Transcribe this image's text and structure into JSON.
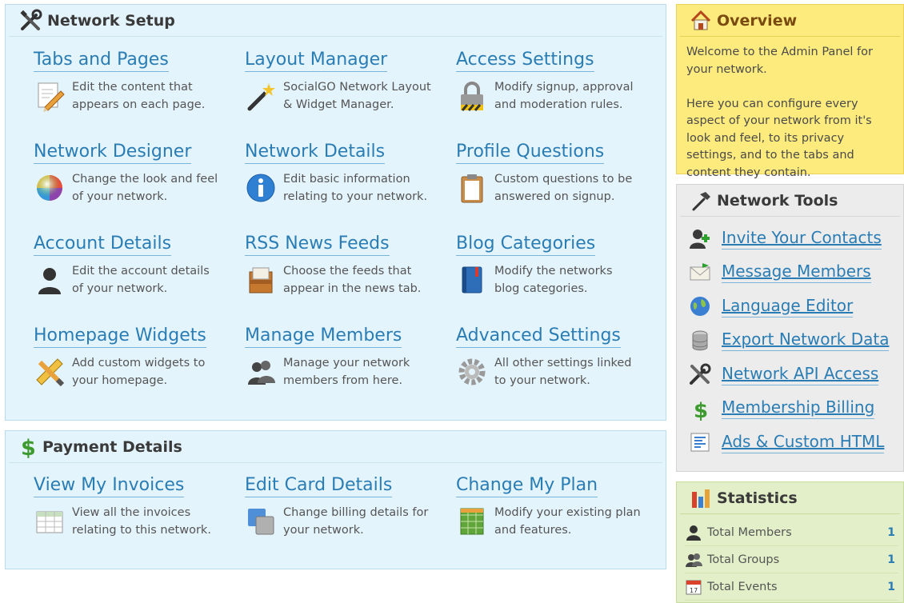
{
  "network_setup": {
    "title": "Network Setup",
    "items": [
      {
        "title": "Tabs and Pages",
        "line1": "Edit the content that",
        "line2": "appears on each page.",
        "icon": "pencil-page-icon"
      },
      {
        "title": "Layout Manager",
        "line1": "SocialGO Network Layout",
        "line2": "& Widget Manager.",
        "icon": "magic-wand-icon"
      },
      {
        "title": "Access Settings",
        "line1": "Modify signup, approval",
        "line2": "and moderation rules.",
        "icon": "padlock-icon"
      },
      {
        "title": "Network Designer",
        "line1": "Change the look and feel",
        "line2": "of your network.",
        "icon": "color-wheel-icon"
      },
      {
        "title": "Network Details",
        "line1": "Edit basic information",
        "line2": "relating to your network.",
        "icon": "info-icon"
      },
      {
        "title": "Profile Questions",
        "line1": "Custom questions to be",
        "line2": "answered on signup.",
        "icon": "clipboard-icon"
      },
      {
        "title": "Account Details",
        "line1": "Edit the account details",
        "line2": "of your network.",
        "icon": "user-icon"
      },
      {
        "title": "RSS News Feeds",
        "line1": "Choose the feeds that",
        "line2": "appear in the news tab.",
        "icon": "inbox-tray-icon"
      },
      {
        "title": "Blog Categories",
        "line1": "Modify the networks",
        "line2": "blog categories.",
        "icon": "book-icon"
      },
      {
        "title": "Homepage Widgets",
        "line1": "Add custom widgets to",
        "line2": "your homepage.",
        "icon": "ruler-pencil-icon"
      },
      {
        "title": "Manage Members",
        "line1": "Manage your network",
        "line2": "members from here.",
        "icon": "users-icon"
      },
      {
        "title": "Advanced Settings",
        "line1": "All other settings linked",
        "line2": "to your network.",
        "icon": "gear-icon"
      }
    ]
  },
  "payment": {
    "title": "Payment Details",
    "items": [
      {
        "title": "View My Invoices",
        "line1": "View all the invoices",
        "line2": "relating to this network.",
        "icon": "table-icon"
      },
      {
        "title": "Edit Card Details",
        "line1": "Change billing details for",
        "line2": "your network.",
        "icon": "cards-icon"
      },
      {
        "title": "Change My Plan",
        "line1": "Modify your existing plan",
        "line2": "and features.",
        "icon": "grid-plan-icon"
      }
    ]
  },
  "overview": {
    "title": "Overview",
    "para1": "Welcome to the Admin Panel for your network.",
    "para2": "Here you can configure every aspect of your network from it's look and feel, to its privacy settings, and to the tabs and content they contain."
  },
  "tools": {
    "title": "Network Tools",
    "items": [
      {
        "label": "Invite Your Contacts",
        "icon": "add-user-icon"
      },
      {
        "label": "Message Members",
        "icon": "envelope-icon"
      },
      {
        "label": "Language Editor",
        "icon": "globe-icon"
      },
      {
        "label": "Export Network Data",
        "icon": "database-icon"
      },
      {
        "label": "Network API Access",
        "icon": "tools-icon"
      },
      {
        "label": "Membership Billing",
        "icon": "dollar-icon"
      },
      {
        "label": "Ads & Custom HTML",
        "icon": "html-doc-icon"
      }
    ]
  },
  "stats": {
    "title": "Statistics",
    "items": [
      {
        "label": "Total Members",
        "value": "1",
        "icon": "member-icon"
      },
      {
        "label": "Total Groups",
        "value": "1",
        "icon": "group-icon"
      },
      {
        "label": "Total Events",
        "value": "1",
        "icon": "calendar-icon"
      }
    ]
  }
}
